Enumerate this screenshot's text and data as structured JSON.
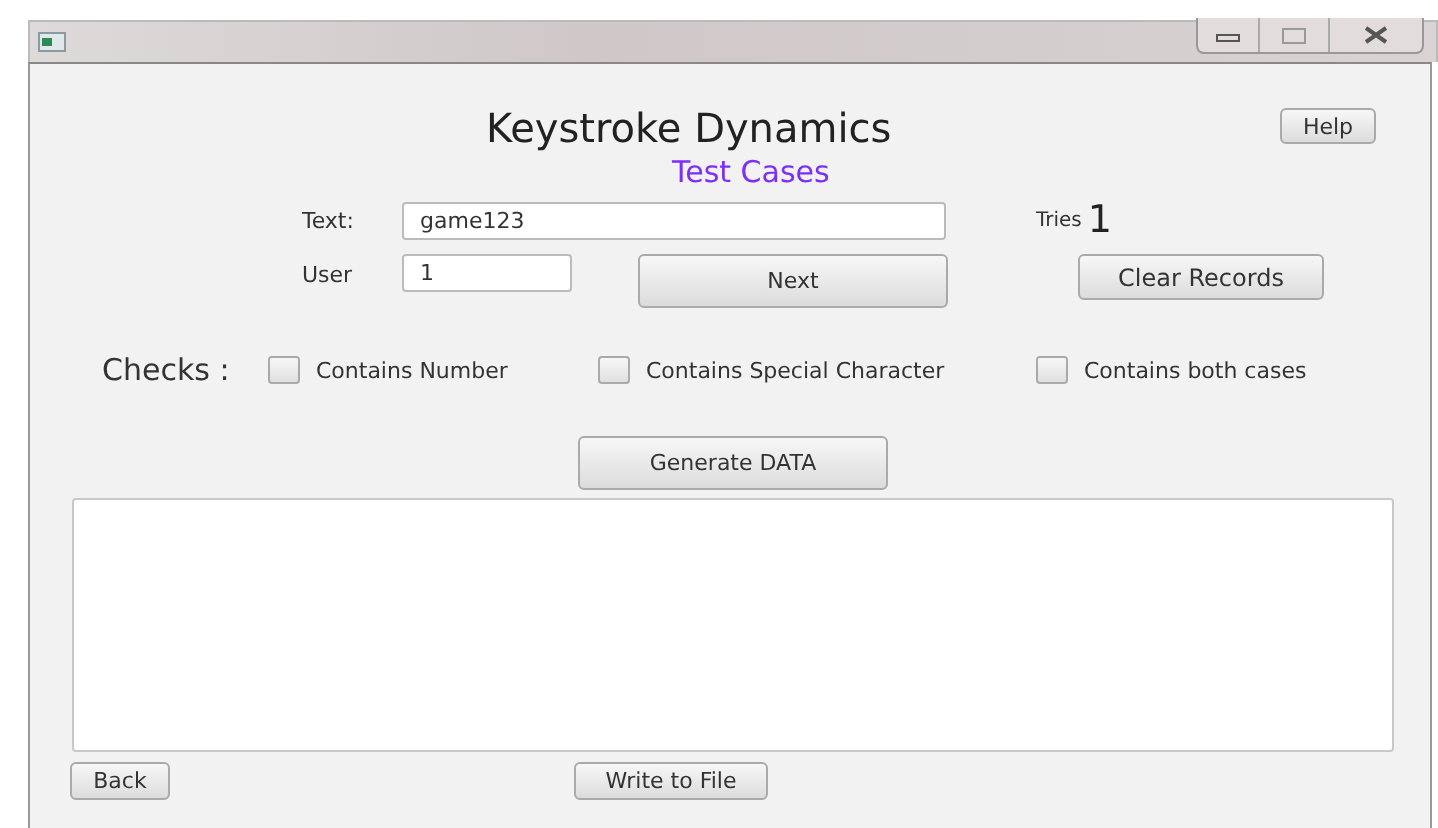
{
  "header": {
    "title": "Keystroke Dynamics",
    "subtitle": "Test Cases",
    "help_button": "Help"
  },
  "text_field": {
    "label": "Text:",
    "value": "game123"
  },
  "tries": {
    "label": "Tries",
    "value": "1"
  },
  "user_field": {
    "label": "User",
    "value": "1"
  },
  "next_button": "Next",
  "clear_button": "Clear Records",
  "checks": {
    "label": "Checks :",
    "options": [
      {
        "label": "Contains Number",
        "checked": false
      },
      {
        "label": "Contains Special Character",
        "checked": false
      },
      {
        "label": "Contains both cases",
        "checked": false
      }
    ]
  },
  "generate_button": "Generate DATA",
  "back_button": "Back",
  "write_button": "Write to File"
}
